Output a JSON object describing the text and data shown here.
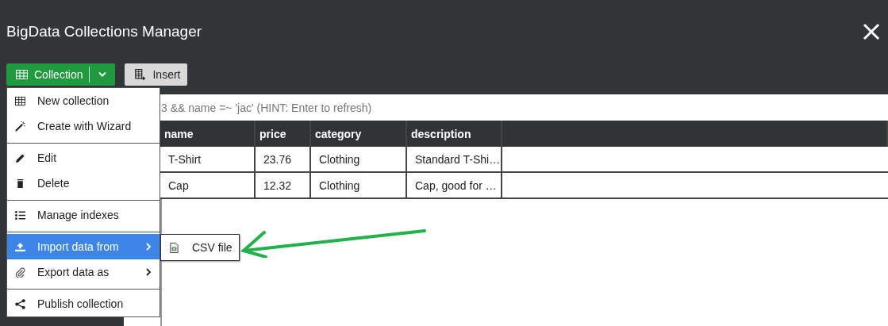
{
  "window": {
    "title": "BigData Collections Manager"
  },
  "toolbar": {
    "collection_button": {
      "label": "Collection"
    },
    "insert_button": {
      "label": "Insert"
    }
  },
  "menu": {
    "groups": [
      [
        {
          "label": "New collection",
          "submenu": false,
          "selected": false
        },
        {
          "label": "Create with Wizard",
          "submenu": false,
          "selected": false
        }
      ],
      [
        {
          "label": "Edit",
          "submenu": false,
          "selected": false
        },
        {
          "label": "Delete",
          "submenu": false,
          "selected": false
        }
      ],
      [
        {
          "label": "Manage indexes",
          "submenu": false,
          "selected": false
        }
      ],
      [
        {
          "label": "Import data from",
          "submenu": true,
          "selected": true
        },
        {
          "label": "Export data as",
          "submenu": true,
          "selected": false
        }
      ],
      [
        {
          "label": "Publish collection",
          "submenu": false,
          "selected": false
        }
      ]
    ]
  },
  "submenu": {
    "items": [
      {
        "label": "CSV file"
      }
    ]
  },
  "filter": {
    "placeholder": "3 && name =~ 'jac' (HINT: Enter to refresh)"
  },
  "table": {
    "columns": [
      "name",
      "price",
      "category",
      "description"
    ],
    "rows": [
      [
        "T-Shirt",
        "23.76",
        "Clothing",
        "Standard T-Shi…"
      ],
      [
        "Cap",
        "12.32",
        "Clothing",
        "Cap, good for …"
      ]
    ]
  }
}
